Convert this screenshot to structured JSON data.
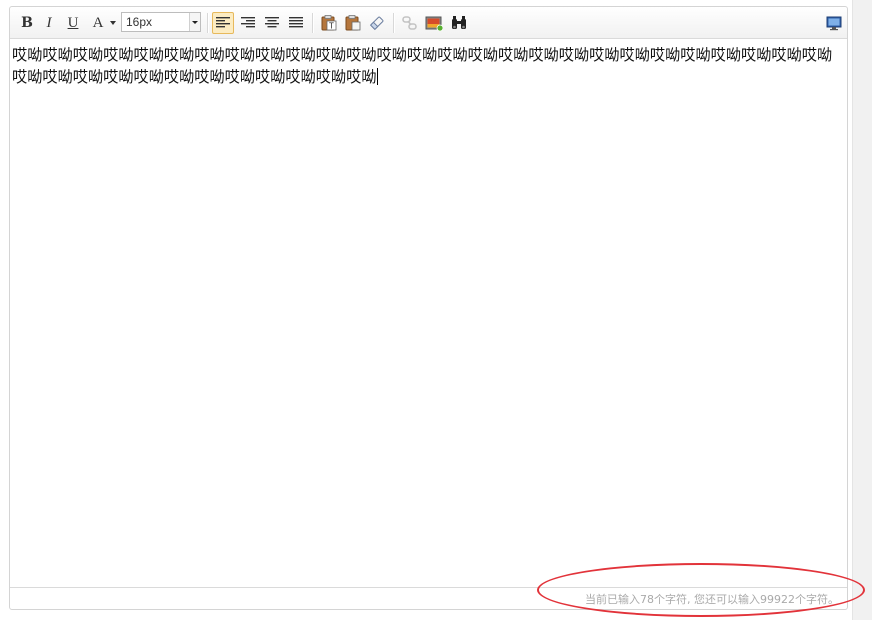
{
  "toolbar": {
    "bold_label": "B",
    "italic_label": "I",
    "underline_label": "U",
    "forecolor_label": "A",
    "fontsize_value": "16px",
    "active_align": "left",
    "buttons": [
      {
        "name": "bold",
        "icon": "bold-icon"
      },
      {
        "name": "italic",
        "icon": "italic-icon"
      },
      {
        "name": "underline",
        "icon": "underline-icon"
      },
      {
        "name": "forecolor",
        "icon": "font-color-icon"
      },
      {
        "name": "fontsize",
        "icon": "select-arrow-icon"
      },
      {
        "name": "justify-left",
        "icon": "align-left-icon"
      },
      {
        "name": "justify-right",
        "icon": "align-right-icon"
      },
      {
        "name": "justify-center",
        "icon": "align-center-icon"
      },
      {
        "name": "justify-full",
        "icon": "align-justify-icon"
      },
      {
        "name": "paste-text",
        "icon": "paste-text-icon"
      },
      {
        "name": "paste",
        "icon": "paste-icon"
      },
      {
        "name": "clear-format",
        "icon": "eraser-icon"
      },
      {
        "name": "link",
        "icon": "link-icon"
      },
      {
        "name": "insert-image",
        "icon": "image-icon"
      },
      {
        "name": "search",
        "icon": "binoculars-icon"
      },
      {
        "name": "fullscreen",
        "icon": "monitor-icon"
      }
    ]
  },
  "content": {
    "text": "哎呦哎呦哎呦哎呦哎呦哎呦哎呦哎呦哎呦哎呦哎呦哎呦哎呦哎呦哎呦哎呦哎呦哎呦哎呦哎呦哎呦哎呦哎呦哎呦哎呦哎呦哎呦哎呦哎呦哎呦哎呦哎呦哎呦哎呦哎呦哎呦哎呦哎呦哎呦"
  },
  "status": {
    "word_count": "当前已输入78个字符, 您还可以输入99922个字符。"
  },
  "colors": {
    "active_button_bg": "#fcecc2",
    "annotation_outline": "#e2333a",
    "status_text": "#aaaaaa"
  }
}
